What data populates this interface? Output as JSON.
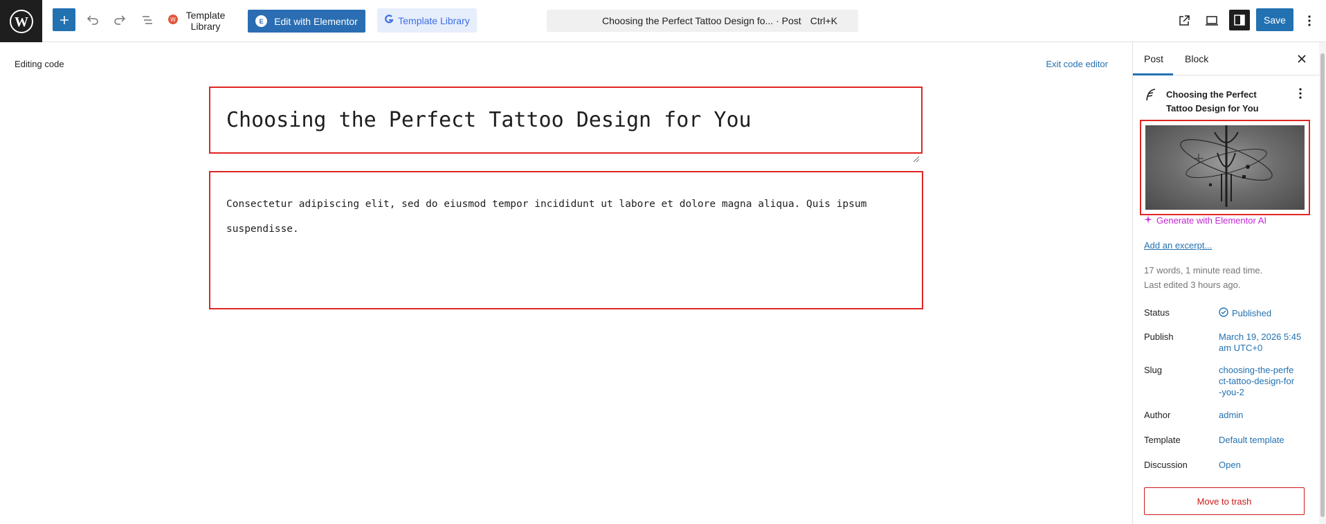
{
  "toolbar": {
    "template_library_label": "Template Library",
    "edit_with_elementor_label": "Edit with Elementor",
    "template_library_button_label": "Template Library",
    "command_title": "Choosing the Perfect Tattoo Design fo... · Post",
    "command_shortcut": "Ctrl+K",
    "save_label": "Save"
  },
  "editor": {
    "editing_label": "Editing code",
    "exit_label": "Exit code editor",
    "post_title": "Choosing the Perfect Tattoo Design for You",
    "post_content": "Consectetur adipiscing elit, sed do eiusmod tempor incididunt ut labore et dolore magna aliqua. Quis ipsum suspendisse."
  },
  "sidebar": {
    "tabs": [
      {
        "label": "Post"
      },
      {
        "label": "Block"
      }
    ],
    "post_title": "Choosing the Perfect Tattoo Design for You",
    "generate_ai_label": "Generate with Elementor AI",
    "add_excerpt_label": "Add an excerpt...",
    "meta_words": "17 words, 1 minute read time.",
    "meta_edited": "Last edited 3 hours ago.",
    "rows": [
      {
        "key": "Status",
        "value": "Published"
      },
      {
        "key": "Publish",
        "value": "March 19, 2026 5:45 am UTC+0"
      },
      {
        "key": "Slug",
        "value": "choosing-the-perfect-tattoo-design-for-you-2"
      },
      {
        "key": "Author",
        "value": "admin"
      },
      {
        "key": "Template",
        "value": "Default template"
      },
      {
        "key": "Discussion",
        "value": "Open"
      }
    ],
    "trash_label": "Move to trash"
  },
  "colors": {
    "accent": "#2271b1",
    "elementor": "#2a6db2",
    "highlight_border": "#e02424",
    "ai": "#c026d3",
    "danger": "#cc1818"
  }
}
